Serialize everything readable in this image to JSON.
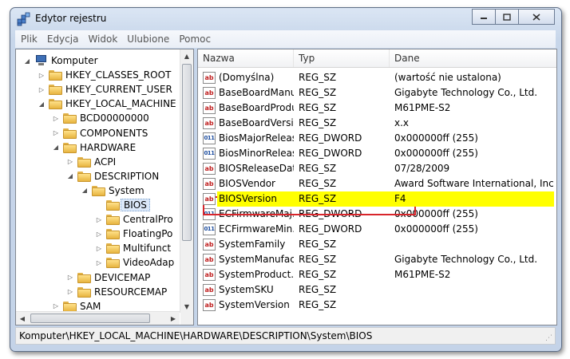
{
  "window": {
    "title": "Edytor rejestru",
    "buttons": [
      "minimize",
      "maximize",
      "close"
    ]
  },
  "menubar": [
    "Plik",
    "Edycja",
    "Widok",
    "Ulubione",
    "Pomoc"
  ],
  "tree": [
    {
      "label": "Komputer",
      "level": 0,
      "expander": "expanded",
      "icon": "computer-icon"
    },
    {
      "label": "HKEY_CLASSES_ROOT",
      "level": 1,
      "expander": "collapsed",
      "icon": "folder-icon"
    },
    {
      "label": "HKEY_CURRENT_USER",
      "level": 1,
      "expander": "collapsed",
      "icon": "folder-icon"
    },
    {
      "label": "HKEY_LOCAL_MACHINE",
      "level": 1,
      "expander": "expanded",
      "icon": "folder-icon"
    },
    {
      "label": "BCD00000000",
      "level": 2,
      "expander": "collapsed",
      "icon": "folder-icon"
    },
    {
      "label": "COMPONENTS",
      "level": 2,
      "expander": "collapsed",
      "icon": "folder-icon"
    },
    {
      "label": "HARDWARE",
      "level": 2,
      "expander": "expanded",
      "icon": "folder-icon"
    },
    {
      "label": "ACPI",
      "level": 3,
      "expander": "collapsed",
      "icon": "folder-icon"
    },
    {
      "label": "DESCRIPTION",
      "level": 3,
      "expander": "expanded",
      "icon": "folder-icon"
    },
    {
      "label": "System",
      "level": 4,
      "expander": "expanded",
      "icon": "folder-icon"
    },
    {
      "label": "BIOS",
      "level": 5,
      "expander": "none",
      "icon": "folder-icon",
      "selected": true
    },
    {
      "label": "CentralPro",
      "level": 5,
      "expander": "collapsed",
      "icon": "folder-icon"
    },
    {
      "label": "FloatingPo",
      "level": 5,
      "expander": "collapsed",
      "icon": "folder-icon"
    },
    {
      "label": "Multifunct",
      "level": 5,
      "expander": "collapsed",
      "icon": "folder-icon"
    },
    {
      "label": "VideoAdap",
      "level": 5,
      "expander": "collapsed",
      "icon": "folder-icon"
    },
    {
      "label": "DEVICEMAP",
      "level": 3,
      "expander": "collapsed",
      "icon": "folder-icon"
    },
    {
      "label": "RESOURCEMAP",
      "level": 3,
      "expander": "collapsed",
      "icon": "folder-icon"
    },
    {
      "label": "SAM",
      "level": 2,
      "expander": "collapsed",
      "icon": "folder-icon"
    }
  ],
  "list": {
    "columns": [
      "Nazwa",
      "Typ",
      "Dane"
    ],
    "rows": [
      {
        "name": "(Domyślna)",
        "type": "REG_SZ",
        "data": "(wartość nie ustalona)",
        "icon": "string-value-icon"
      },
      {
        "name": "BaseBoardManu...",
        "type": "REG_SZ",
        "data": "Gigabyte Technology Co., Ltd.",
        "icon": "string-value-icon"
      },
      {
        "name": "BaseBoardProdu...",
        "type": "REG_SZ",
        "data": "M61PME-S2",
        "icon": "string-value-icon"
      },
      {
        "name": "BaseBoardVersion",
        "type": "REG_SZ",
        "data": "x.x",
        "icon": "string-value-icon"
      },
      {
        "name": "BiosMajorRelease",
        "type": "REG_DWORD",
        "data": "0x000000ff (255)",
        "icon": "dword-value-icon"
      },
      {
        "name": "BiosMinorRelease",
        "type": "REG_DWORD",
        "data": "0x000000ff (255)",
        "icon": "dword-value-icon"
      },
      {
        "name": "BIOSReleaseDate",
        "type": "REG_SZ",
        "data": "07/28/2009",
        "icon": "string-value-icon"
      },
      {
        "name": "BIOSVendor",
        "type": "REG_SZ",
        "data": "Award Software International, Inc.",
        "icon": "string-value-icon"
      },
      {
        "name": "BIOSVersion",
        "type": "REG_SZ",
        "data": "F4",
        "icon": "string-value-icon",
        "highlighted": true
      },
      {
        "name": "ECFirmwareMaj...",
        "type": "REG_DWORD",
        "data": "0x000000ff (255)",
        "icon": "dword-value-icon"
      },
      {
        "name": "ECFirmwareMin...",
        "type": "REG_DWORD",
        "data": "0x000000ff (255)",
        "icon": "dword-value-icon"
      },
      {
        "name": "SystemFamily",
        "type": "REG_SZ",
        "data": "",
        "icon": "string-value-icon"
      },
      {
        "name": "SystemManufac...",
        "type": "REG_SZ",
        "data": "Gigabyte Technology Co., Ltd.",
        "icon": "string-value-icon"
      },
      {
        "name": "SystemProduct...",
        "type": "REG_SZ",
        "data": "M61PME-S2",
        "icon": "string-value-icon"
      },
      {
        "name": "SystemSKU",
        "type": "REG_SZ",
        "data": "",
        "icon": "string-value-icon"
      },
      {
        "name": "SystemVersion",
        "type": "REG_SZ",
        "data": "",
        "icon": "string-value-icon"
      }
    ]
  },
  "statusbar": {
    "path": "Komputer\\HKEY_LOCAL_MACHINE\\HARDWARE\\DESCRIPTION\\System\\BIOS"
  },
  "colors": {
    "highlight": "#ffff00",
    "annotation_box": "#d8252b",
    "title_gradient": "#c7d6ea"
  }
}
